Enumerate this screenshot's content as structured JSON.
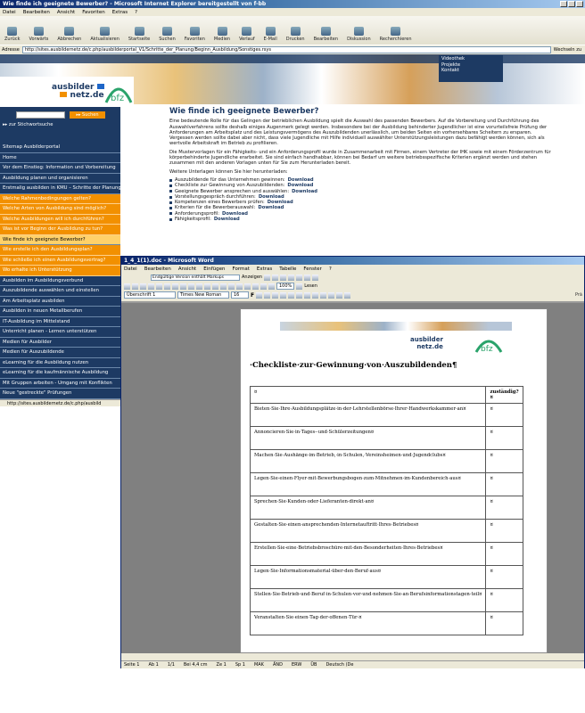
{
  "ie": {
    "title": "Wie finde ich geeignete Bewerber? - Microsoft Internet Explorer bereitgestellt von f-bb",
    "menu": [
      "Datei",
      "Bearbeiten",
      "Ansicht",
      "Favoriten",
      "Extras",
      "?"
    ],
    "toolbar": [
      "Zurück",
      "Vorwärts",
      "Abbrechen",
      "Aktualisieren",
      "Startseite",
      "Suchen",
      "Favoriten",
      "Medien",
      "Verlauf",
      "E-Mail",
      "Drucken",
      "Bearbeiten",
      "Diskussion",
      "Recherchieren"
    ],
    "address_label": "Adresse",
    "address": "http://sites.ausbildernetz.de/c.php/ausbilderportal_V1/Schritte_der_Planung/Beginn_Ausbildung/Sonstiges.rsys",
    "go": "Wechseln zu",
    "topmenu": [
      "Videothek",
      "Projekte",
      "Kontakt"
    ],
    "logo_a": "ausbilder",
    "logo_b": "netz.de",
    "search_btn": "Suchen",
    "stichwort": "zur Stichwortsuche",
    "nav": [
      {
        "t": "Sitemap Ausbilderportal",
        "c": "dark"
      },
      {
        "t": "Home",
        "c": "dark"
      },
      {
        "t": "Vor dem Einstieg: Information und Vorbereitung",
        "c": "dark"
      },
      {
        "t": "Ausbildung planen und organisieren",
        "c": "dark"
      },
      {
        "t": "Erstmalig ausbilden in KMU – Schritte der Planung",
        "c": "dark"
      },
      {
        "t": "Welche Rahmenbedingungen gelten?",
        "c": "orange"
      },
      {
        "t": "Welche Arten von Ausbildung sind möglich?",
        "c": "orange"
      },
      {
        "t": "Welche Ausbildungen will ich durchführen?",
        "c": "orange"
      },
      {
        "t": "Was ist vor Beginn der Ausbildung zu tun?",
        "c": "orange"
      },
      {
        "t": "Wie finde ich geeignete Bewerber?",
        "c": "sel"
      },
      {
        "t": "Wie erstelle ich den Ausbildungsplan?",
        "c": "orange"
      },
      {
        "t": "Wie schließe ich einen Ausbildungsvertrag?",
        "c": "orange"
      },
      {
        "t": "Wo erhalte ich Unterstützung",
        "c": "orange"
      },
      {
        "t": "Ausbilden im Ausbildungsverbund",
        "c": "dark"
      },
      {
        "t": "Auszubildende auswählen und einstellen",
        "c": "dark"
      },
      {
        "t": "Am Arbeitsplatz ausbilden",
        "c": "dark"
      },
      {
        "t": "Ausbilden in neuen Metallberufen",
        "c": "dark"
      },
      {
        "t": "IT-Ausbildung im Mittelstand",
        "c": "dark"
      },
      {
        "t": "Unterricht planen - Lernen unterstützen",
        "c": "dark"
      },
      {
        "t": "Medien für Ausbilder",
        "c": "dark"
      },
      {
        "t": "Medien für Auszubildende",
        "c": "dark"
      },
      {
        "t": "eLearning für die Ausbildung nutzen",
        "c": "dark"
      },
      {
        "t": "eLearning für die kaufmännische Ausbildung",
        "c": "dark"
      },
      {
        "t": "Mit Gruppen arbeiten - Umgang mit Konflikten",
        "c": "dark"
      },
      {
        "t": "Neue \"gestreckte\" Prüfungen",
        "c": "dark"
      }
    ],
    "status_url": "http://sites.ausbildernetz.de/c.php/ausbild",
    "heading": "Wie finde ich geeignete Bewerber?",
    "p1": "Eine bedeutende Rolle für das Gelingen der betrieblichen Ausbildung spielt die Auswahl des passenden Bewerbers. Auf die Vorbereitung und Durchführung des Auswahlverfahrens sollte deshalb einiges Augenmerk gelegt werden. Insbesondere bei der Ausbildung behinderter Jugendlicher ist eine vorurteilsfreie Prüfung der Anforderungen am Arbeitsplatz und des Leistungsvermögens des Auszubildenden unerlässlich, um beiden Seiten ein vorhersehbares Scheitern zu ersparen. Vergessen werden sollte dabei aber nicht, dass viele Jugendliche mit Hilfe individuell auswählter Unterstützungsleistungen dazu befähigt werden können, sich als wertvolle Arbeitskraft im Betrieb zu profilieren.",
    "p2": "Die Mustervorlagen für ein Fähigkeits- und ein Anforderungsprofil wurde in Zusammenarbeit mit Firmen, einem Vertreter der IHK sowie mit einem Förderzentrum für körperbehinderte Jugendliche erarbeitet. Sie sind einfach handhabbar, können bei Bedarf um weitere betriebsspezifische Kriterien ergänzt werden und stehen zusammen mit den anderen Vorlagen unten für Sie zum Herunterladen bereit.",
    "p3": "Weitere Unterlagen können Sie hier herunterladen:",
    "downloads": [
      {
        "t": "Auszubildende für das Unternehmen gewinnen: ",
        "l": "Download"
      },
      {
        "t": "Checkliste zur Gewinnung von Auszubildenden: ",
        "l": "Download"
      },
      {
        "t": "Geeignete Bewerber ansprechen und auswählen: ",
        "l": "Download"
      },
      {
        "t": "Vorstellungsgespräch durchführen: ",
        "l": "Download"
      },
      {
        "t": "Kompetenzen eines Bewerbers prüfen: ",
        "l": "Download"
      },
      {
        "t": "Kriterien für die Bewerberauswahl: ",
        "l": "Download"
      },
      {
        "t": "Anforderungsprofil: ",
        "l": "Download"
      },
      {
        "t": "Fähigkeitsprofil: ",
        "l": "Download"
      }
    ]
  },
  "word": {
    "title": "1_4_1(1).doc - Microsoft Word",
    "menu": [
      "Datei",
      "Bearbeiten",
      "Ansicht",
      "Einfügen",
      "Format",
      "Extras",
      "Tabelle",
      "Fenster",
      "?"
    ],
    "markup": "Endgültige Version enthält Markups",
    "anzeigen": "Anzeigen",
    "style": "Überschrift 1",
    "font": "Times New Roman",
    "size": "16",
    "zoom": "100%",
    "lesen": "Lesen",
    "doc_title": "·Checkliste·zur·Gewinnung·von·Auszubildenden¶",
    "col_head": "zuständig?¤",
    "rows": [
      "Bieten·Sie·Ihre·Ausbildungsplätze·in·der·Lehrstellenbörse·Ihrer·Handwerkskammer·an¤",
      "Annoncieren·Sie·in·Tages-·und·Schülerzeitungen¤",
      "Machen·Sie·Aushänge·im·Betrieb,·in·Schulen,·Vereinsheimen·und·Jugendclubs¤",
      "Legen·Sie·einen·Flyer·mit·Bewerbungsbogen·zum·Mitnehmen·im·Kundenbereich·aus¤",
      "Sprechen·Sie·Kunden·oder·Lieferanten·direkt·an¤",
      "Gestalten·Sie·einen·ansprechenden·Internetauftritt·Ihres·Betriebes¤",
      "Erstellen·Sie·eine·Betriebsbroschüre·mit·den·Besonderheiten·Ihres·Betriebes¤",
      "Legen·Sie·Informationsmaterial·über·den·Beruf·aus¤",
      "Stellen·Sie·Betrieb·und·Beruf·in·Schulen·vor·und·nehmen·Sie·an·Berufsinformationstagen·teil¤",
      "Veranstalten·Sie·einen·Tag·der·offenen·Tür·¤"
    ],
    "status": [
      "Seite 1",
      "Ab 1",
      "1/1",
      "Bei 4,4 cm",
      "Ze 1",
      "Sp 1",
      "MAK",
      "ÄND",
      "ERW",
      "ÜB",
      "Deutsch (De"
    ],
    "pra": "Prä"
  }
}
